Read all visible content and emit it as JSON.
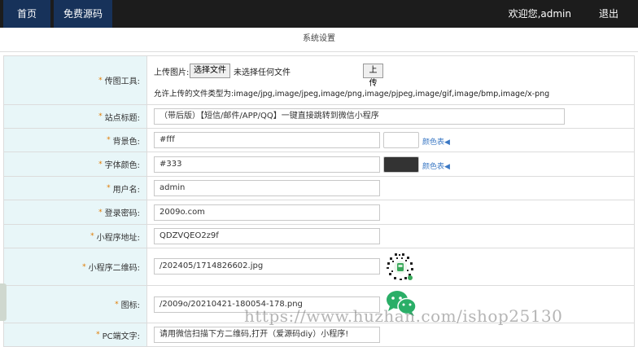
{
  "nav": {
    "home": "首页",
    "free_source": "免费源码",
    "welcome": "欢迎您,admin",
    "logout": "退出"
  },
  "subtitle": "系统设置",
  "upload": {
    "label": "传图工具:",
    "prefix": "上传图片:",
    "choose_button": "选择文件",
    "no_file": "未选择任何文件",
    "upload_button": "上传",
    "allowed_types": "允许上传的文件类型为:image/jpg,image/jpeg,image/png,image/pjpeg,image/gif,image/bmp,image/x-png"
  },
  "fields": {
    "site_title": {
      "label": "站点标题:",
      "value": "（带后版）【短信/邮件/APP/QQ】一键直接跳转到微信小程序"
    },
    "bg_color": {
      "label": "背景色:",
      "value": "#fff",
      "swatch": "#ffffff",
      "link": "颜色表◀"
    },
    "font_color": {
      "label": "字体颜色:",
      "value": "#333",
      "swatch": "#333333",
      "link": "颜色表◀"
    },
    "username": {
      "label": "用户名:",
      "value": "admin"
    },
    "password": {
      "label": "登录密码:",
      "value": "2009o.com"
    },
    "mini_addr": {
      "label": "小程序地址:",
      "value": "QDZVQEO2z9f"
    },
    "mini_qr": {
      "label": "小程序二维码:",
      "value": "/202405/1714826602.jpg"
    },
    "icon": {
      "label": "图标:",
      "value": "/2009o/20210421-180054-178.png"
    },
    "pc_text": {
      "label": "PC端文字:",
      "value": "请用微信扫描下方二维码,打开（爱源码diy）小程序!"
    }
  },
  "star": "*",
  "watermark": "https://www.huzhan.com/ishop25130",
  "colors": {
    "nav_active": "#17325a",
    "topbar": "#1c1c1c",
    "label_bg": "#e8f6f8",
    "link": "#3b78c4",
    "wechat_green": "#2aae67"
  }
}
